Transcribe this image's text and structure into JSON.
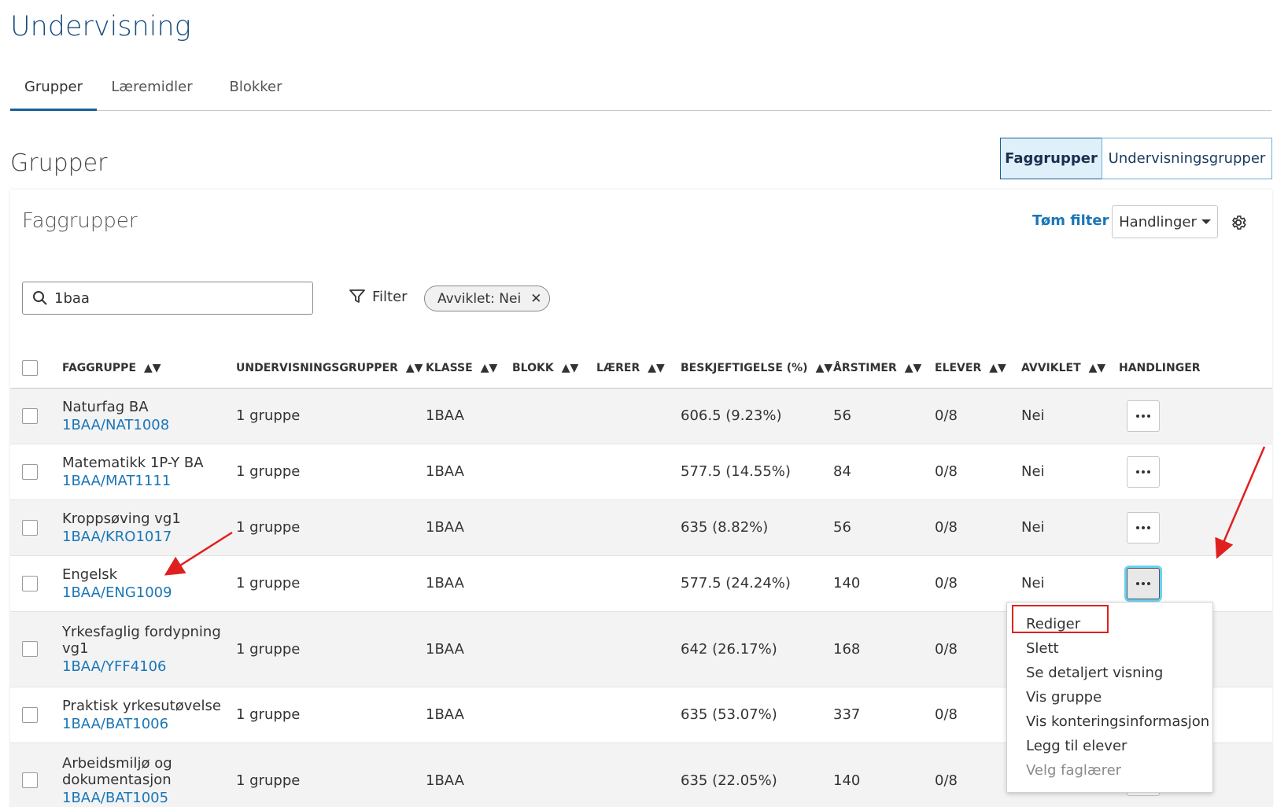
{
  "page_title": "Undervisning",
  "tabs": [
    {
      "label": "Grupper",
      "active": true
    },
    {
      "label": "Læremidler",
      "active": false
    },
    {
      "label": "Blokker",
      "active": false
    }
  ],
  "section_title": "Grupper",
  "view_toggle": {
    "active": "Faggrupper",
    "inactive": "Undervisningsgrupper"
  },
  "card": {
    "title": "Faggrupper",
    "clear_filter": "Tøm filter",
    "actions_button": "Handlinger"
  },
  "search": {
    "value": "1baa"
  },
  "filter": {
    "label": "Filter",
    "chip": "Avviklet: Nei"
  },
  "columns": [
    "FAGGRUPPE",
    "UNDERVISNINGSGRUPPER",
    "KLASSE",
    "BLOKK",
    "LÆRER",
    "BESKJEFTIGELSE (%)",
    "ÅRSTIMER",
    "ELEVER",
    "AVVIKLET",
    "HANDLINGER"
  ],
  "rows": [
    {
      "name": "Naturfag BA",
      "code": "1BAA/NAT1008",
      "groups": "1 gruppe",
      "klasse": "1BAA",
      "blokk": "",
      "laerer": "",
      "beskj": "606.5 (9.23%)",
      "arstimer": "56",
      "elever": "0/8",
      "avviklet": "Nei"
    },
    {
      "name": "Matematikk 1P-Y BA",
      "code": "1BAA/MAT1111",
      "groups": "1 gruppe",
      "klasse": "1BAA",
      "blokk": "",
      "laerer": "",
      "beskj": "577.5 (14.55%)",
      "arstimer": "84",
      "elever": "0/8",
      "avviklet": "Nei"
    },
    {
      "name": "Kroppsøving vg1",
      "code": "1BAA/KRO1017",
      "groups": "1 gruppe",
      "klasse": "1BAA",
      "blokk": "",
      "laerer": "",
      "beskj": "635 (8.82%)",
      "arstimer": "56",
      "elever": "0/8",
      "avviklet": "Nei"
    },
    {
      "name": "Engelsk",
      "code": "1BAA/ENG1009",
      "groups": "1 gruppe",
      "klasse": "1BAA",
      "blokk": "",
      "laerer": "",
      "beskj": "577.5 (24.24%)",
      "arstimer": "140",
      "elever": "0/8",
      "avviklet": "Nei"
    },
    {
      "name": "Yrkesfaglig fordypning vg1",
      "code": "1BAA/YFF4106",
      "groups": "1 gruppe",
      "klasse": "1BAA",
      "blokk": "",
      "laerer": "",
      "beskj": "642 (26.17%)",
      "arstimer": "168",
      "elever": "0/8",
      "avviklet": ""
    },
    {
      "name": "Praktisk yrkesutøvelse",
      "code": "1BAA/BAT1006",
      "groups": "1 gruppe",
      "klasse": "1BAA",
      "blokk": "",
      "laerer": "",
      "beskj": "635 (53.07%)",
      "arstimer": "337",
      "elever": "0/8",
      "avviklet": ""
    },
    {
      "name": "Arbeidsmiljø og dokumentasjon",
      "code": "1BAA/BAT1005",
      "groups": "1 gruppe",
      "klasse": "1BAA",
      "blokk": "",
      "laerer": "",
      "beskj": "635 (22.05%)",
      "arstimer": "140",
      "elever": "0/8",
      "avviklet": ""
    }
  ],
  "context_menu": {
    "items": [
      "Rediger",
      "Slett",
      "Se detaljert visning",
      "Vis gruppe",
      "Vis konteringsinformasjon",
      "Legg til elever",
      "Velg faglærer"
    ],
    "disabled": [
      "Velg faglærer"
    ],
    "highlighted": "Rediger"
  },
  "colors": {
    "accent": "#1a5e96",
    "link": "#1a76b6",
    "annotation": "#e02020",
    "focus": "#6ad0f2"
  }
}
